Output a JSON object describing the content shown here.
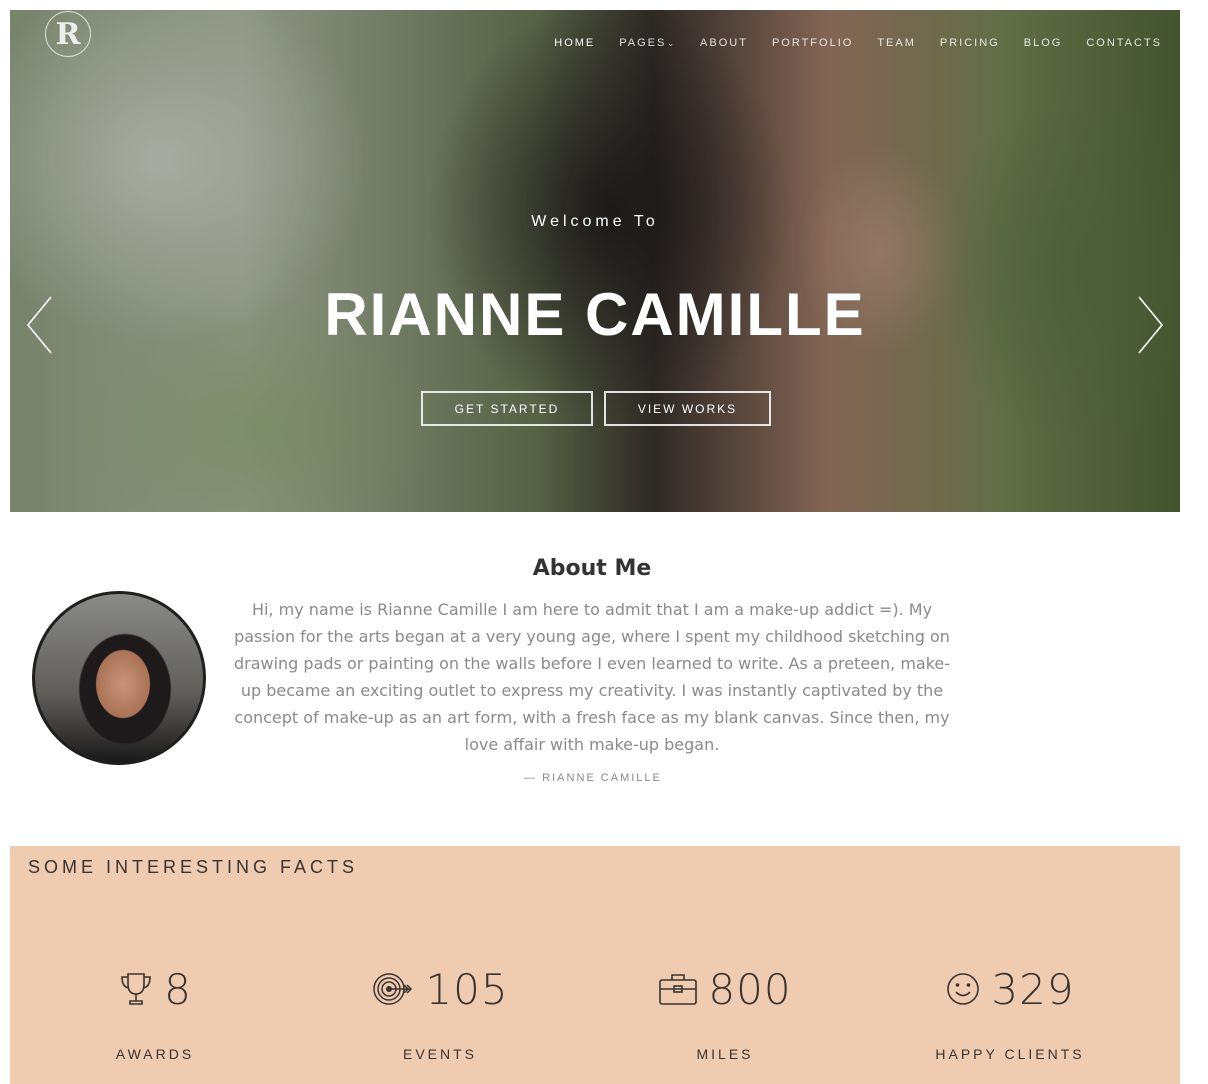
{
  "header": {
    "logo_text": "R",
    "nav": [
      {
        "label": "HOME",
        "active": true
      },
      {
        "label": "PAGES",
        "has_dropdown": true
      },
      {
        "label": "ABOUT"
      },
      {
        "label": "PORTFOLIO"
      },
      {
        "label": "TEAM"
      },
      {
        "label": "PRICING"
      },
      {
        "label": "BLOG"
      },
      {
        "label": "CONTACTS"
      }
    ]
  },
  "hero": {
    "welcome": "Welcome To",
    "title": "RIANNE CAMILLE",
    "primary_button": "GET STARTED",
    "secondary_button": "VIEW WORKS",
    "prev_icon": "chevron-left-icon",
    "next_icon": "chevron-right-icon"
  },
  "about": {
    "heading_light": "About",
    "heading_bold": "Me",
    "text": "Hi, my name is Rianne Camille I am here to admit that I am a make-up addict =). My passion for the arts began at a very young age, where I spent my childhood sketching on drawing pads or painting on the walls before I even learned to write. As a preteen, make-up became an exciting outlet to express my creativity. I was instantly captivated by the concept of make-up as an art form, with a fresh face as my blank canvas. Since then, my love affair with make-up began.",
    "signature": "— RIANNE CAMILLE"
  },
  "facts": {
    "title": "SOME INTERESTING FACTS",
    "background": "#eecbb1",
    "items": [
      {
        "icon": "trophy-icon",
        "number": "8",
        "label": "AWARDS"
      },
      {
        "icon": "target-icon",
        "number": "105",
        "label": "EVENTS"
      },
      {
        "icon": "briefcase-icon",
        "number": "800",
        "label": "MILES"
      },
      {
        "icon": "smiley-icon",
        "number": "329",
        "label": "HAPPY CLIENTS"
      }
    ]
  }
}
